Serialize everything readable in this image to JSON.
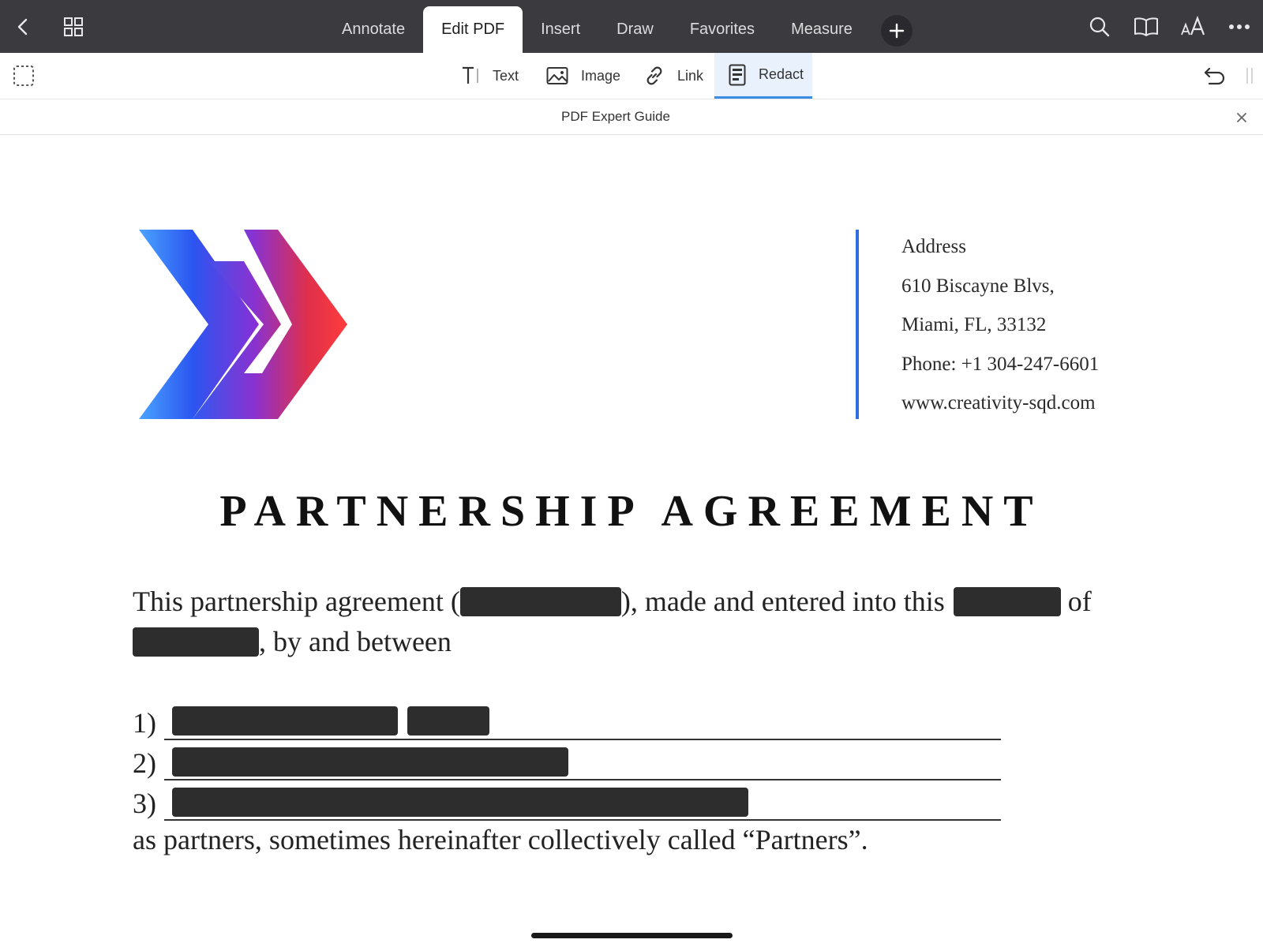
{
  "toolbar": {
    "tabs": [
      {
        "label": "Annotate"
      },
      {
        "label": "Edit PDF"
      },
      {
        "label": "Insert"
      },
      {
        "label": "Draw"
      },
      {
        "label": "Favorites"
      },
      {
        "label": "Measure"
      }
    ],
    "active_tab": "Edit PDF",
    "icons": [
      "back-icon",
      "grid-icon",
      "plus-icon",
      "search-icon",
      "book-icon",
      "text-size-icon",
      "more-icon"
    ]
  },
  "edit_tools": {
    "items": [
      {
        "label": "Text",
        "icon": "text-tool-icon"
      },
      {
        "label": "Image",
        "icon": "image-icon"
      },
      {
        "label": "Link",
        "icon": "link-icon"
      },
      {
        "label": "Redact",
        "icon": "redact-icon"
      }
    ],
    "active_tool": "Redact"
  },
  "guide": {
    "title": "PDF Expert Guide"
  },
  "document": {
    "address": {
      "label": "Address",
      "line1": "610 Biscayne Blvs,",
      "line2": "Miami, FL, 33132",
      "phone": "Phone: +1 304-247-6601",
      "website": "www.creativity-sqd.com"
    },
    "title": "PARTNERSHIP AGREEMENT",
    "intro_part1": "This partnership agreement (",
    "intro_part2": "), made and entered into this",
    "intro_part3": "of",
    "intro_part4": ", by and between",
    "list_numbers": [
      "1)",
      "2)",
      "3)"
    ],
    "closing": "as partners, sometimes hereinafter collectively called “Partners”."
  },
  "colors": {
    "topbar": "#3b3b3f",
    "accent_blue": "#3a8ce0",
    "logo_blue": "#2f6ee0",
    "logo_red": "#e8383a",
    "redaction": "#2d2d2d"
  }
}
